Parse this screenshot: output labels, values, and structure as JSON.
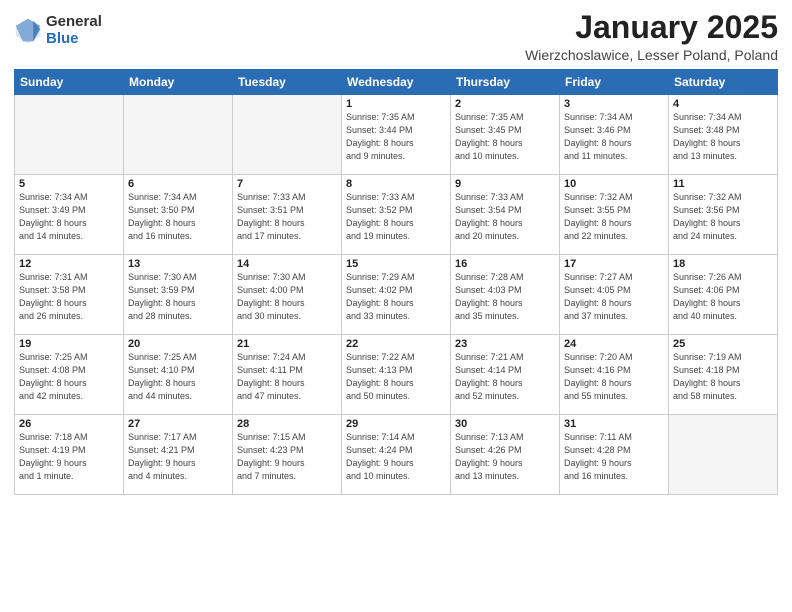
{
  "header": {
    "logo_general": "General",
    "logo_blue": "Blue",
    "month_title": "January 2025",
    "location": "Wierzchoslawice, Lesser Poland, Poland"
  },
  "weekdays": [
    "Sunday",
    "Monday",
    "Tuesday",
    "Wednesday",
    "Thursday",
    "Friday",
    "Saturday"
  ],
  "weeks": [
    [
      {
        "day": "",
        "info": ""
      },
      {
        "day": "",
        "info": ""
      },
      {
        "day": "",
        "info": ""
      },
      {
        "day": "1",
        "info": "Sunrise: 7:35 AM\nSunset: 3:44 PM\nDaylight: 8 hours\nand 9 minutes."
      },
      {
        "day": "2",
        "info": "Sunrise: 7:35 AM\nSunset: 3:45 PM\nDaylight: 8 hours\nand 10 minutes."
      },
      {
        "day": "3",
        "info": "Sunrise: 7:34 AM\nSunset: 3:46 PM\nDaylight: 8 hours\nand 11 minutes."
      },
      {
        "day": "4",
        "info": "Sunrise: 7:34 AM\nSunset: 3:48 PM\nDaylight: 8 hours\nand 13 minutes."
      }
    ],
    [
      {
        "day": "5",
        "info": "Sunrise: 7:34 AM\nSunset: 3:49 PM\nDaylight: 8 hours\nand 14 minutes."
      },
      {
        "day": "6",
        "info": "Sunrise: 7:34 AM\nSunset: 3:50 PM\nDaylight: 8 hours\nand 16 minutes."
      },
      {
        "day": "7",
        "info": "Sunrise: 7:33 AM\nSunset: 3:51 PM\nDaylight: 8 hours\nand 17 minutes."
      },
      {
        "day": "8",
        "info": "Sunrise: 7:33 AM\nSunset: 3:52 PM\nDaylight: 8 hours\nand 19 minutes."
      },
      {
        "day": "9",
        "info": "Sunrise: 7:33 AM\nSunset: 3:54 PM\nDaylight: 8 hours\nand 20 minutes."
      },
      {
        "day": "10",
        "info": "Sunrise: 7:32 AM\nSunset: 3:55 PM\nDaylight: 8 hours\nand 22 minutes."
      },
      {
        "day": "11",
        "info": "Sunrise: 7:32 AM\nSunset: 3:56 PM\nDaylight: 8 hours\nand 24 minutes."
      }
    ],
    [
      {
        "day": "12",
        "info": "Sunrise: 7:31 AM\nSunset: 3:58 PM\nDaylight: 8 hours\nand 26 minutes."
      },
      {
        "day": "13",
        "info": "Sunrise: 7:30 AM\nSunset: 3:59 PM\nDaylight: 8 hours\nand 28 minutes."
      },
      {
        "day": "14",
        "info": "Sunrise: 7:30 AM\nSunset: 4:00 PM\nDaylight: 8 hours\nand 30 minutes."
      },
      {
        "day": "15",
        "info": "Sunrise: 7:29 AM\nSunset: 4:02 PM\nDaylight: 8 hours\nand 33 minutes."
      },
      {
        "day": "16",
        "info": "Sunrise: 7:28 AM\nSunset: 4:03 PM\nDaylight: 8 hours\nand 35 minutes."
      },
      {
        "day": "17",
        "info": "Sunrise: 7:27 AM\nSunset: 4:05 PM\nDaylight: 8 hours\nand 37 minutes."
      },
      {
        "day": "18",
        "info": "Sunrise: 7:26 AM\nSunset: 4:06 PM\nDaylight: 8 hours\nand 40 minutes."
      }
    ],
    [
      {
        "day": "19",
        "info": "Sunrise: 7:25 AM\nSunset: 4:08 PM\nDaylight: 8 hours\nand 42 minutes."
      },
      {
        "day": "20",
        "info": "Sunrise: 7:25 AM\nSunset: 4:10 PM\nDaylight: 8 hours\nand 44 minutes."
      },
      {
        "day": "21",
        "info": "Sunrise: 7:24 AM\nSunset: 4:11 PM\nDaylight: 8 hours\nand 47 minutes."
      },
      {
        "day": "22",
        "info": "Sunrise: 7:22 AM\nSunset: 4:13 PM\nDaylight: 8 hours\nand 50 minutes."
      },
      {
        "day": "23",
        "info": "Sunrise: 7:21 AM\nSunset: 4:14 PM\nDaylight: 8 hours\nand 52 minutes."
      },
      {
        "day": "24",
        "info": "Sunrise: 7:20 AM\nSunset: 4:16 PM\nDaylight: 8 hours\nand 55 minutes."
      },
      {
        "day": "25",
        "info": "Sunrise: 7:19 AM\nSunset: 4:18 PM\nDaylight: 8 hours\nand 58 minutes."
      }
    ],
    [
      {
        "day": "26",
        "info": "Sunrise: 7:18 AM\nSunset: 4:19 PM\nDaylight: 9 hours\nand 1 minute."
      },
      {
        "day": "27",
        "info": "Sunrise: 7:17 AM\nSunset: 4:21 PM\nDaylight: 9 hours\nand 4 minutes."
      },
      {
        "day": "28",
        "info": "Sunrise: 7:15 AM\nSunset: 4:23 PM\nDaylight: 9 hours\nand 7 minutes."
      },
      {
        "day": "29",
        "info": "Sunrise: 7:14 AM\nSunset: 4:24 PM\nDaylight: 9 hours\nand 10 minutes."
      },
      {
        "day": "30",
        "info": "Sunrise: 7:13 AM\nSunset: 4:26 PM\nDaylight: 9 hours\nand 13 minutes."
      },
      {
        "day": "31",
        "info": "Sunrise: 7:11 AM\nSunset: 4:28 PM\nDaylight: 9 hours\nand 16 minutes."
      },
      {
        "day": "",
        "info": ""
      }
    ]
  ]
}
